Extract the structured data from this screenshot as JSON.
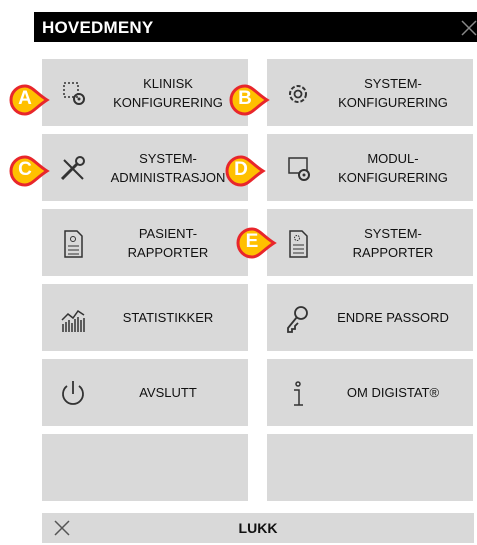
{
  "header": {
    "title": "HOVEDMENY",
    "close_icon": "close-icon"
  },
  "tiles": [
    {
      "label": "KLINISK\nKONFIGURERING",
      "icon": "clinical-config-icon"
    },
    {
      "label": "SYSTEM-\nKONFIGURERING",
      "icon": "gear-icon"
    },
    {
      "label": "SYSTEM-\nADMINISTRASJON",
      "icon": "tools-icon"
    },
    {
      "label": "MODUL-\nKONFIGURERING",
      "icon": "module-config-icon"
    },
    {
      "label": "PASIENT-\nRAPPORTER",
      "icon": "patient-report-icon"
    },
    {
      "label": "SYSTEM-\nRAPPORTER",
      "icon": "system-report-icon"
    },
    {
      "label": "STATISTIKKER",
      "icon": "statistics-icon"
    },
    {
      "label": "ENDRE PASSORD",
      "icon": "key-icon"
    },
    {
      "label": "AVSLUTT",
      "icon": "power-icon"
    },
    {
      "label": "OM DIGISTAT®",
      "icon": "info-icon"
    },
    {
      "label": "",
      "icon": ""
    },
    {
      "label": "",
      "icon": ""
    }
  ],
  "badges": [
    "A",
    "B",
    "C",
    "D",
    "E"
  ],
  "footer": {
    "label": "LUKK",
    "icon": "close-icon"
  },
  "colors": {
    "header_bg": "#000000",
    "tile_bg": "#d9d9d9",
    "badge_fill": "#ffc000",
    "badge_stroke": "#e8262b"
  }
}
